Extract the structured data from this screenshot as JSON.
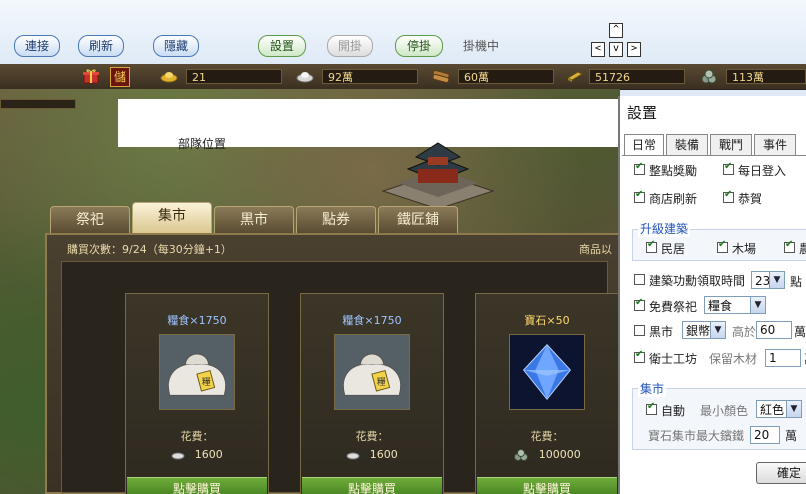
{
  "toolbar": {
    "connect_label": "連接",
    "refresh_label": "刷新",
    "hide_label": "隱藏",
    "settings_label": "設置",
    "start_hang_label": "開掛",
    "stop_hang_label": "停掛",
    "status_text": "掛機中",
    "arrows": {
      "up": "^",
      "left": "<",
      "down": "v",
      "right": ">"
    }
  },
  "resources": [
    {
      "icon": "gold-ingot-icon",
      "value": "21"
    },
    {
      "icon": "silver-ingot-icon",
      "value": "92萬"
    },
    {
      "icon": "wood-log-icon",
      "value": "60萬"
    },
    {
      "icon": "iron-bar-icon",
      "value": "51726"
    },
    {
      "icon": "stone-pile-icon",
      "value": "113萬"
    }
  ],
  "resource_icons": {
    "gift": "gift-box-icon",
    "storage": "儲"
  },
  "scene": {
    "location_text": "部隊位置"
  },
  "market": {
    "tabs": [
      "祭祀",
      "集市",
      "黒市",
      "點券",
      "鐵匠鋪"
    ],
    "active_tab": 1,
    "purchase_info": "購買次數：9/24（每30分鐘+1）",
    "hint": "商品以",
    "cards": [
      {
        "title": "糧食×1750",
        "item": "grain-sack",
        "cost_label": "花費：",
        "cost_icon": "silver-ingot-icon",
        "cost_value": "1600",
        "button": "點擊購買"
      },
      {
        "title": "糧食×1750",
        "item": "grain-sack",
        "cost_label": "花費：",
        "cost_icon": "silver-ingot-icon",
        "cost_value": "1600",
        "button": "點擊購買"
      },
      {
        "title": "寶石×50",
        "item": "blue-gem",
        "cost_label": "花費：",
        "cost_icon": "stone-pile-icon",
        "cost_value": "100000",
        "button": "點擊購買"
      }
    ]
  },
  "settings": {
    "title": "設置",
    "tabs": [
      "日常",
      "裝備",
      "戰鬥",
      "事件"
    ],
    "active_tab": 0,
    "daily": {
      "hourly_reward": "整點獎勵",
      "daily_login": "每日登入",
      "shop_refresh": "商店刷新",
      "congratulate": "恭賀"
    },
    "upgrade_group": {
      "title": "升級建築",
      "residence": "民居",
      "lumber_yard": "木場",
      "third_cut": "農"
    },
    "build_merit": {
      "label": "建築功勳領取時間",
      "value": "23",
      "unit": "點"
    },
    "free_sacrifice": {
      "label": "免費祭祀",
      "value": "糧食"
    },
    "black_market": {
      "label": "黒市",
      "currency": "銀幣",
      "above_label": "高於",
      "above_value": "60",
      "unit": "萬"
    },
    "guard_workshop": {
      "label": "衛士工坊",
      "keep_label": "保留木材",
      "keep_value": "1",
      "unit_cut": "萬"
    },
    "market_group": {
      "title": "集市",
      "auto_label": "自動",
      "min_color_label": "最小顏色",
      "min_color_value": "紅色",
      "gem_max_label": "寶石集市最大鑌鐵",
      "gem_max_value": "20",
      "gem_max_unit": "萬"
    },
    "confirm_label": "確定"
  },
  "colors": {
    "rice_title": "#9ec3ff",
    "gem_title": "#ffd86a",
    "accent": "#2255bb"
  }
}
